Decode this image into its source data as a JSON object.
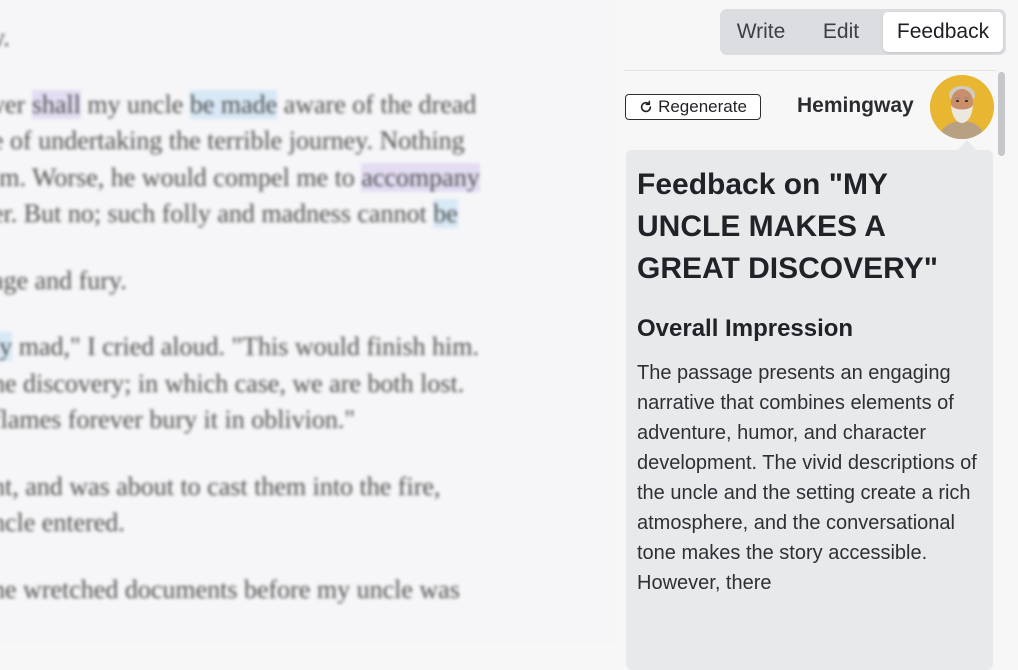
{
  "editor": {
    "lines": [
      [
        {
          "t": "v.",
          "h": ""
        }
      ],
      [
        {
          "t": "",
          "h": "gap"
        }
      ],
      [
        {
          "t": "ver ",
          "h": ""
        },
        {
          "t": "shall",
          "h": "purple"
        },
        {
          "t": " my uncle ",
          "h": ""
        },
        {
          "t": "be made",
          "h": "blue"
        },
        {
          "t": " aware of the dread",
          "h": ""
        }
      ],
      [
        {
          "t": "e of undertaking the terrible journey. Nothing",
          "h": ""
        }
      ],
      [
        {
          "t": "im. Worse, he would compel me to ",
          "h": ""
        },
        {
          "t": "accompany",
          "h": "purple"
        }
      ],
      [
        {
          "t": "er. But no; such folly and madness cannot ",
          "h": ""
        },
        {
          "t": "be",
          "h": "blue"
        }
      ],
      [
        {
          "t": "",
          "h": "gap"
        }
      ],
      [
        {
          "t": "age and fury.",
          "h": ""
        }
      ],
      [
        {
          "t": "",
          "h": "gap"
        }
      ],
      [
        {
          "t": "ly",
          "h": "blue"
        },
        {
          "t": " mad,\" I cried aloud. \"This would finish him.",
          "h": ""
        }
      ],
      [
        {
          "t": "he discovery; in which case, we are both lost.",
          "h": ""
        }
      ],
      [
        {
          "t": "flames forever bury it in oblivion.\"",
          "h": ""
        }
      ],
      [
        {
          "t": "",
          "h": "gap"
        }
      ],
      [
        {
          "t": "nt, and was about to cast them into the fire,",
          "h": ""
        }
      ],
      [
        {
          "t": "ncle entered.",
          "h": ""
        }
      ],
      [
        {
          "t": "",
          "h": "gap"
        }
      ],
      [
        {
          "t": "he wretched documents before my uncle was",
          "h": ""
        }
      ]
    ]
  },
  "tabs": {
    "write": "Write",
    "edit": "Edit",
    "feedback": "Feedback",
    "active": "feedback"
  },
  "toolbar": {
    "regenerate_label": "Regenerate",
    "author_name": "Hemingway"
  },
  "feedback": {
    "title": "Feedback on \"MY UNCLE MAKES A GREAT DISCOVERY\"",
    "section_heading": "Overall Impression",
    "body": "The passage presents an engaging narrative that combines elements of adventure, humor, and character development. The vivid descriptions of the uncle and the setting create a rich atmosphere, and the conversational tone makes the story accessible. However, there"
  },
  "colors": {
    "highlight_purple": "#e4dcf3",
    "highlight_blue": "#d7e8f6",
    "active_tab_bg": "#ffffff",
    "avatar_bg": "#e9b632",
    "feedback_bubble_bg": "#e8e9eb"
  },
  "icons": {
    "regenerate": "refresh-icon",
    "author": "avatar"
  }
}
